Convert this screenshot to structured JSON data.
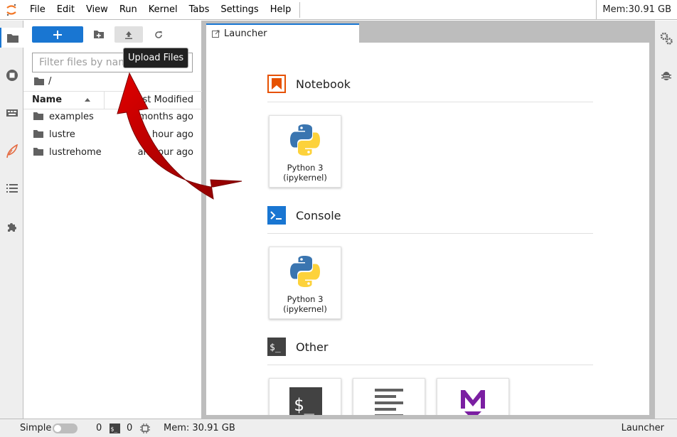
{
  "menubar": {
    "items": [
      "File",
      "Edit",
      "View",
      "Run",
      "Kernel",
      "Tabs",
      "Settings",
      "Help"
    ],
    "memory": "Mem:30.91 GB"
  },
  "filebrowser": {
    "filter_placeholder": "Filter files by name",
    "breadcrumb": "/",
    "columns": {
      "name": "Name",
      "modified": "Last Modified"
    },
    "files": [
      {
        "name": "examples",
        "modified": "7 months ago"
      },
      {
        "name": "lustre",
        "modified": "an hour ago"
      },
      {
        "name": "lustrehome",
        "modified": "an hour ago"
      }
    ],
    "tooltip": "Upload Files"
  },
  "dock": {
    "tab_label": "Launcher",
    "sections": [
      {
        "title": "Notebook",
        "cards": [
          {
            "label": "Python 3 (ipykernel)"
          }
        ]
      },
      {
        "title": "Console",
        "cards": [
          {
            "label": "Python 3 (ipykernel)"
          }
        ]
      },
      {
        "title": "Other",
        "cards": []
      }
    ],
    "card_label_lines": [
      "Python 3",
      "(ipykernel)"
    ]
  },
  "statusbar": {
    "mode_label": "Simple",
    "kernels_count": "0",
    "terminals_count": "0",
    "memory": "Mem: 30.91 GB",
    "current": "Launcher"
  },
  "colors": {
    "accent": "#1976d2",
    "notebook_orange": "#e65100",
    "annotation_arrow": "#c00000"
  }
}
